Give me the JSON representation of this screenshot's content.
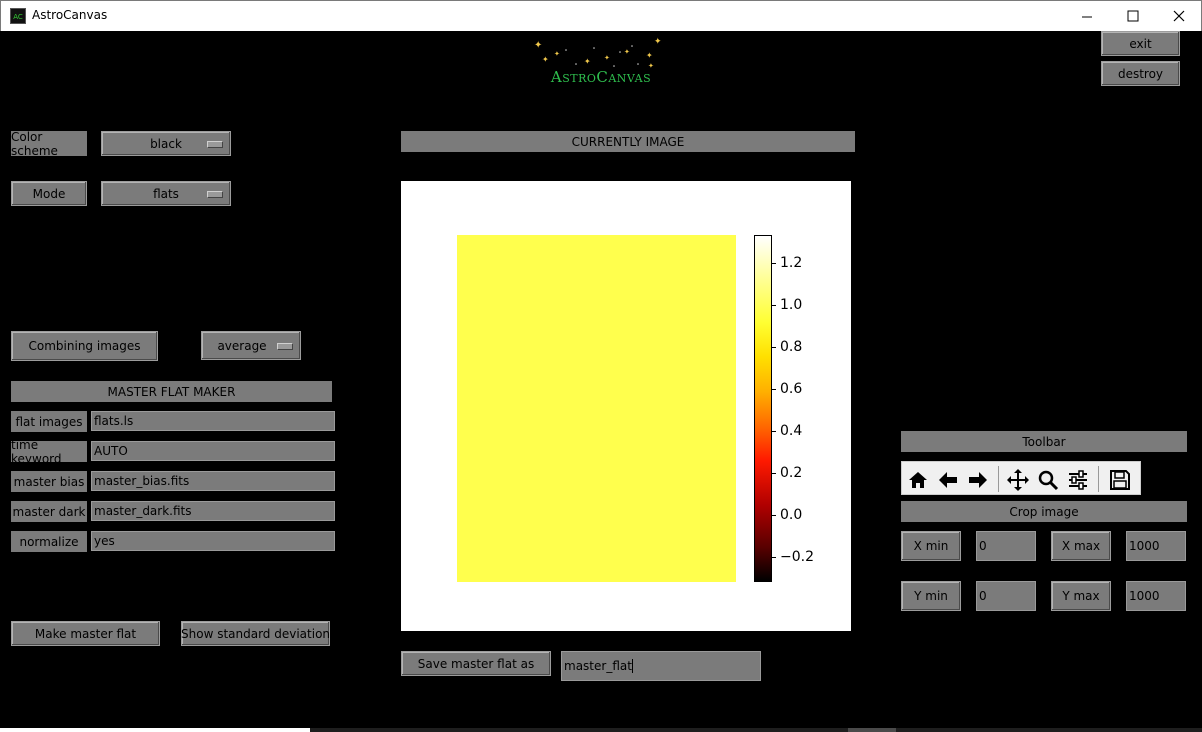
{
  "window": {
    "title": "AstroCanvas",
    "icon_text": "AC"
  },
  "logo": {
    "text": "AstroCanvas"
  },
  "top_buttons": {
    "exit": "exit",
    "destroy": "destroy"
  },
  "settings": {
    "color_scheme_label": "Color scheme",
    "color_scheme_value": "black",
    "mode_label": "Mode",
    "mode_value": "flats",
    "combining_label": "Combining images",
    "combining_value": "average"
  },
  "master_flat": {
    "header": "MASTER FLAT MAKER",
    "rows": [
      {
        "label": "flat images",
        "value": "flats.ls"
      },
      {
        "label": "time keyword",
        "value": "AUTO"
      },
      {
        "label": "master bias",
        "value": "master_bias.fits"
      },
      {
        "label": "master dark",
        "value": "master_dark.fits"
      },
      {
        "label": "normalize",
        "value": "yes"
      }
    ],
    "make_button": "Make master flat",
    "std_button": "Show standard deviation"
  },
  "image_panel": {
    "header": "CURRENTLY IMAGE",
    "save_button": "Save master flat as",
    "save_value": "master_flat"
  },
  "colorbar": {
    "colormap": "hot",
    "image_color": "#ffff4d",
    "ticks": [
      "1.2",
      "1.0",
      "0.8",
      "0.6",
      "0.4",
      "0.2",
      "0.0",
      "−0.2"
    ]
  },
  "toolbar": {
    "header": "Toolbar",
    "icons": [
      "home-icon",
      "back-arrow-icon",
      "forward-arrow-icon",
      "pan-icon",
      "zoom-icon",
      "configure-icon",
      "save-icon"
    ]
  },
  "crop": {
    "header": "Crop image",
    "xmin_label": "X min",
    "xmin_value": "0",
    "xmax_label": "X max",
    "xmax_value": "1000",
    "ymin_label": "Y min",
    "ymin_value": "0",
    "ymax_label": "Y max",
    "ymax_value": "1000"
  }
}
